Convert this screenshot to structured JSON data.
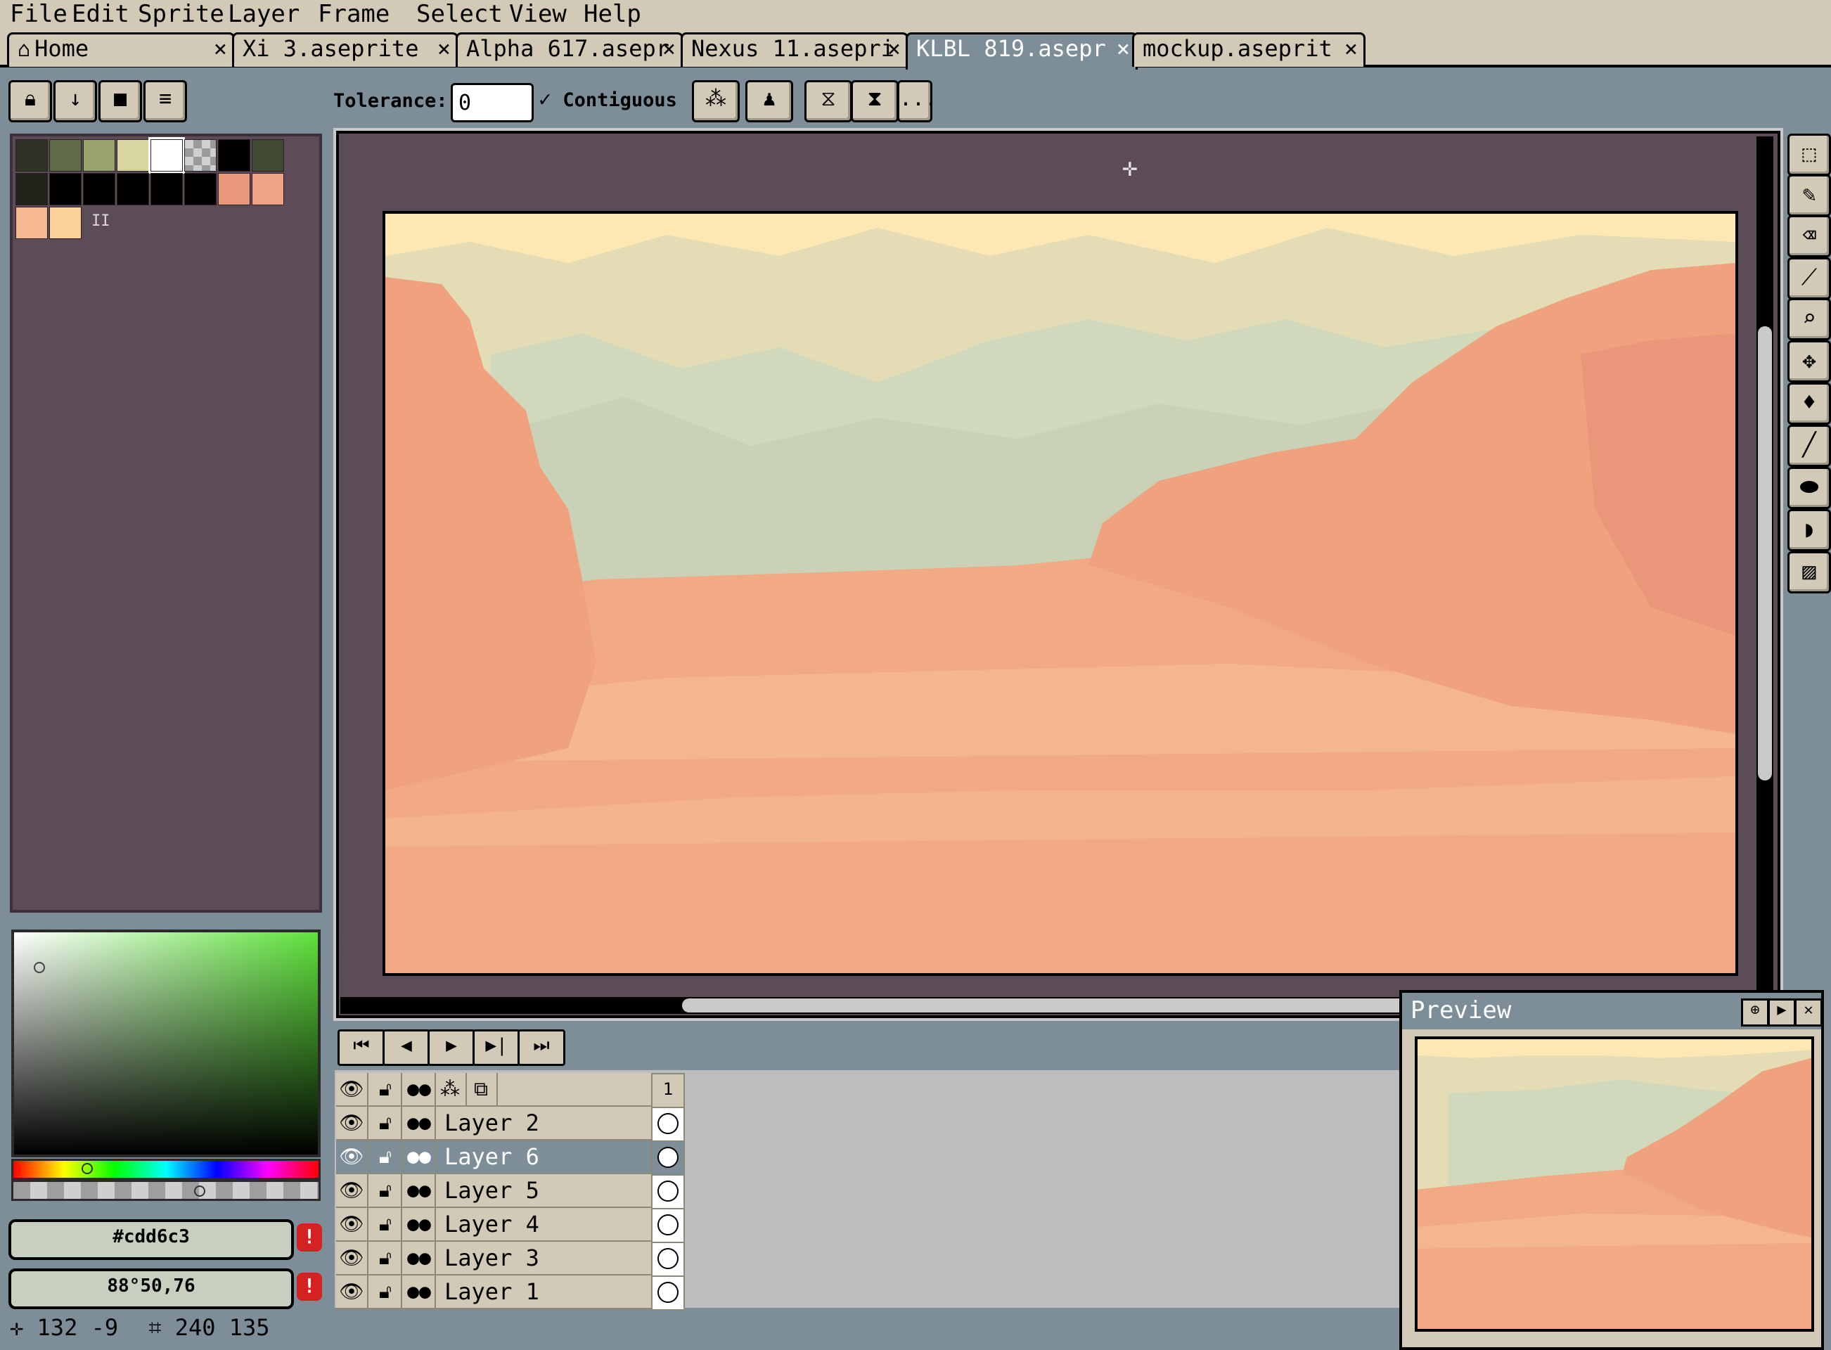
{
  "menu": [
    "File",
    "Edit",
    "Sprite",
    "Layer",
    "Frame",
    "Select",
    "View",
    "Help"
  ],
  "tabs": [
    {
      "label": "Home",
      "close": "×"
    },
    {
      "label": "Xi 3.aseprite",
      "close": "×"
    },
    {
      "label": "Alpha 617.asepr",
      "close": "×"
    },
    {
      "label": "Nexus 11.asepri",
      "close": "×"
    },
    {
      "label": "KLBL 819.asepr",
      "close": "×"
    },
    {
      "label": "mockup.aseprit",
      "close": "×"
    }
  ],
  "active_tab": 4,
  "context_bar": {
    "tolerance_label": "Tolerance:",
    "tolerance_value": "0",
    "contiguous_label": "Contiguous",
    "contiguous_checked": true,
    "more_label": "..."
  },
  "palette": {
    "colors": [
      "#2f3326",
      "#5f6b48",
      "#9aa36c",
      "#d8d59f",
      "#ffffff",
      "checker",
      "#000000",
      "#3f4a31",
      "#22241c",
      "#000000",
      "#000000",
      "#000000",
      "#000000",
      "#000000",
      "#e8977a",
      "#efa487",
      "#f6b994",
      "#fbd39a"
    ],
    "selected_index": 4,
    "count_marker": "II"
  },
  "color_picker": {
    "hex_label": "#cdd6c3",
    "hsv_label": "88°50,76",
    "warning_glyph": "!"
  },
  "timeline": {
    "frame_header": "1",
    "layers": [
      {
        "name": "Layer 2",
        "selected": false
      },
      {
        "name": "Layer 6",
        "selected": true
      },
      {
        "name": "Layer 5",
        "selected": false
      },
      {
        "name": "Layer 4",
        "selected": false
      },
      {
        "name": "Layer 3",
        "selected": false
      },
      {
        "name": "Layer 1",
        "selected": false
      }
    ]
  },
  "status": {
    "cursor": "132 -9",
    "size": "240 135"
  },
  "preview": {
    "title": "Preview"
  },
  "colors": {
    "ui_face": "#d2cab6",
    "ui_bg": "#7d8e99",
    "editor_bg": "#5c4c58",
    "sky": "#fde8b4",
    "haze": "#d0d8bd",
    "sand": "#f2aa84"
  }
}
